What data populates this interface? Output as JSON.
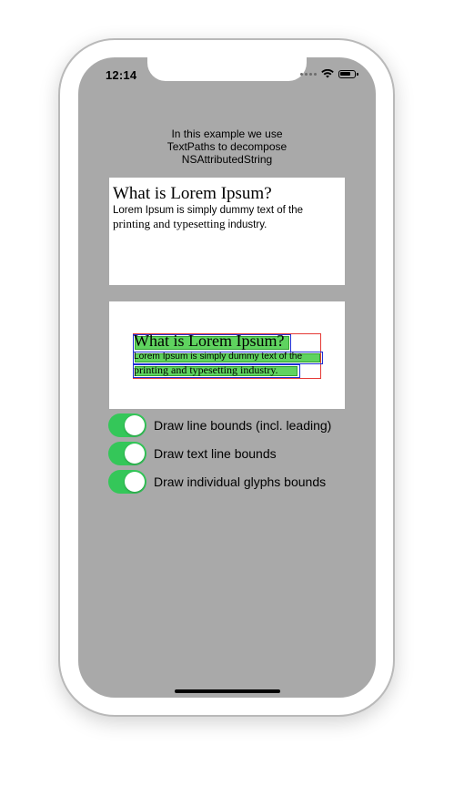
{
  "status_bar": {
    "time": "12:14",
    "icons": [
      "cellular-signal-icon",
      "wifi-icon",
      "battery-icon"
    ]
  },
  "intro_text": "In this example we use\nTextPaths to decompose\nNSAttributedString",
  "sample": {
    "title": "What is Lorem Ipsum?",
    "line_1": "Lorem Ipsum is simply dummy text of the",
    "line_2_serif": "printing and typesetting",
    "line_2_sans": " industry."
  },
  "decomposed": {
    "title": "What is Lorem Ipsum?",
    "line_1": "Lorem Ipsum is simply dummy text of the",
    "line_2": "printing and typesetting industry."
  },
  "toggles": [
    {
      "label": "Draw line bounds (incl. leading)",
      "on": true
    },
    {
      "label": "Draw text line bounds",
      "on": true
    },
    {
      "label": "Draw individual glyphs bounds",
      "on": true
    }
  ],
  "colors": {
    "screen_background": "#a9a9a9",
    "toggle_on": "#34c759",
    "line_bounds": "#e53935",
    "text_line_bounds": "#1e2fd6",
    "glyph_bounds": "#5fd35f"
  }
}
